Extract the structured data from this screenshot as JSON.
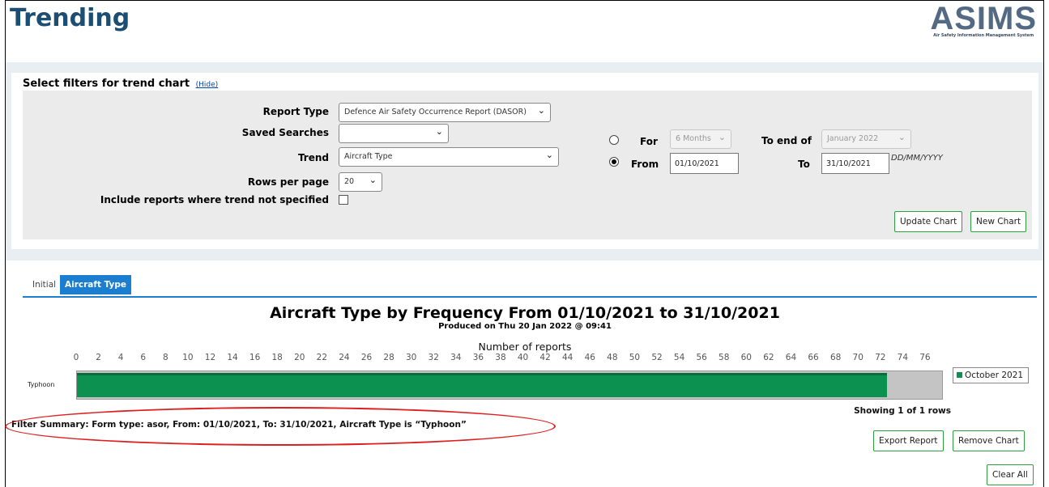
{
  "header": {
    "title": "Trending",
    "logo_text": "ASIMS",
    "logo_subtitle": "Air Safety Information Management System"
  },
  "filters": {
    "title": "Select filters for trend chart",
    "hide_link": "(Hide)",
    "report_type": {
      "label": "Report Type",
      "value": "Defence Air Safety Occurrence Report (DASOR)"
    },
    "saved_searches": {
      "label": "Saved Searches",
      "value": ""
    },
    "trend": {
      "label": "Trend",
      "value": "Aircraft Type"
    },
    "rows_per_page": {
      "label": "Rows per page",
      "value": "20"
    },
    "include_unspecified": {
      "label": "Include reports where trend not specified",
      "checked": false
    },
    "for": {
      "label": "For",
      "value": "6 Months",
      "selected": false
    },
    "to_end_of": {
      "label": "To end of",
      "value": "January 2022"
    },
    "from": {
      "label": "From",
      "value": "01/10/2021",
      "selected": true
    },
    "to": {
      "label": "To",
      "value": "31/10/2021"
    },
    "date_hint": "DD/MM/YYYY",
    "update_button": "Update Chart",
    "new_button": "New Chart"
  },
  "tabs": [
    {
      "label": "Initial",
      "active": false
    },
    {
      "label": "Aircraft Type",
      "active": true
    }
  ],
  "chart_data": {
    "type": "bar",
    "orientation": "horizontal",
    "title": "Aircraft Type by Frequency From 01/10/2021 to 31/10/2021",
    "subtitle": "Produced on Thu 20 Jan 2022 @ 09:41",
    "xlabel": "Number of reports",
    "ylabel": "",
    "xlim": [
      0,
      77
    ],
    "x_ticks": [
      0,
      2,
      4,
      6,
      8,
      10,
      12,
      14,
      16,
      18,
      20,
      22,
      24,
      26,
      28,
      30,
      32,
      34,
      36,
      38,
      40,
      42,
      44,
      46,
      48,
      50,
      52,
      54,
      56,
      58,
      60,
      62,
      64,
      66,
      68,
      70,
      72,
      74,
      76
    ],
    "categories": [
      "Typhoon"
    ],
    "series": [
      {
        "name": "October 2021",
        "values": [
          72.5
        ],
        "color": "#0d9150"
      }
    ],
    "legend_position": "right",
    "grid": false
  },
  "results": {
    "showing": "Showing 1 of 1 rows",
    "filter_summary": "Filter Summary: Form type: asor, From: 01/10/2021, To: 31/10/2021, Aircraft Type is “Typhoon”"
  },
  "actions": {
    "export": "Export Report",
    "remove": "Remove Chart",
    "clear_all": "Clear All"
  },
  "colors": {
    "accent": "#1b7ed0",
    "title": "#1c4e73",
    "button_border": "#2e9e3e",
    "bar": "#0d9150",
    "annotation": "#dd1f1f"
  }
}
